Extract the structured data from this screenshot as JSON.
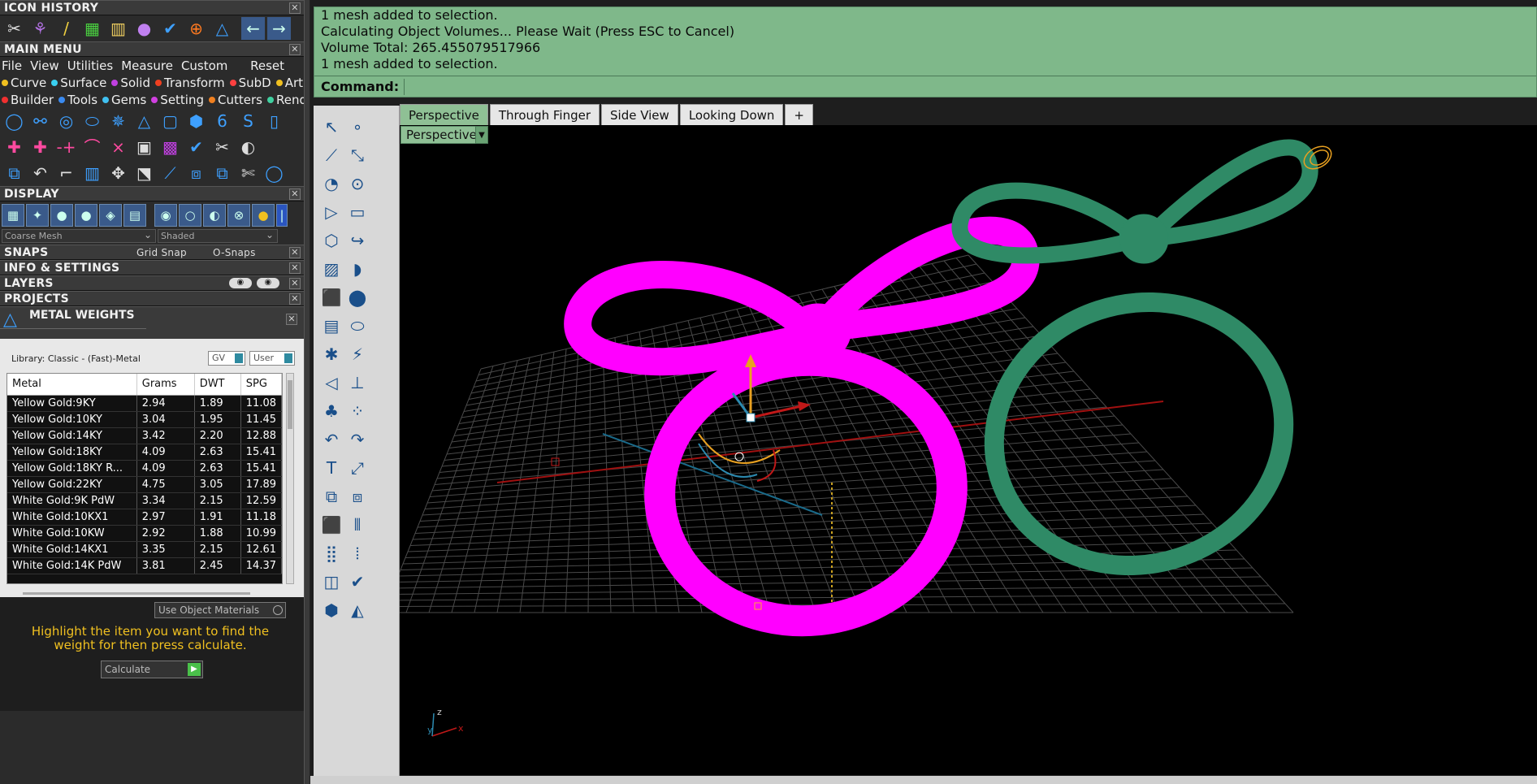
{
  "icon_history": {
    "title": "ICON HISTORY",
    "close": "✕"
  },
  "main_menu": {
    "title": "MAIN MENU",
    "close": "✕",
    "items": [
      "File",
      "View",
      "Utilities",
      "Measure",
      "Custom"
    ],
    "reset": "Reset",
    "cat_row1": [
      {
        "label": "Curve",
        "color": "#f0c020"
      },
      {
        "label": "Surface",
        "color": "#3ad0f0"
      },
      {
        "label": "Solid",
        "color": "#c040e0"
      },
      {
        "label": "Transform",
        "color": "#f04020"
      },
      {
        "label": "SubD",
        "color": "#ff4040"
      },
      {
        "label": "Art",
        "color": "#f0c020"
      }
    ],
    "cat_row2": [
      {
        "label": "Builder",
        "color": "#f03030"
      },
      {
        "label": "Tools",
        "color": "#3a8af0"
      },
      {
        "label": "Gems",
        "color": "#40c0f0"
      },
      {
        "label": "Setting",
        "color": "#d040e0"
      },
      {
        "label": "Cutters",
        "color": "#f08020"
      },
      {
        "label": "Render",
        "color": "#40d0a0"
      }
    ]
  },
  "display": {
    "title": "DISPLAY",
    "close": "✕",
    "mesh_combo": "Coarse Mesh",
    "shade_combo": "Shaded"
  },
  "snaps": {
    "title": "SNAPS",
    "grid_snap": "Grid Snap",
    "osnaps": "O-Snaps",
    "close": "✕"
  },
  "info": {
    "title": "INFO & SETTINGS",
    "close": "✕"
  },
  "layers": {
    "title": "LAYERS",
    "close": "✕"
  },
  "projects": {
    "title": "PROJECTS",
    "close": "✕"
  },
  "metal_weights": {
    "title": "METAL WEIGHTS",
    "close": "✕",
    "library": "Library: Classic - (Fast)-Metal",
    "gv": "GV",
    "user": "User",
    "columns": [
      "Metal",
      "Grams",
      "DWT",
      "SPG"
    ],
    "rows": [
      [
        "Yellow Gold:9KY",
        "2.94",
        "1.89",
        "11.08"
      ],
      [
        "Yellow Gold:10KY",
        "3.04",
        "1.95",
        "11.45"
      ],
      [
        "Yellow Gold:14KY",
        "3.42",
        "2.20",
        "12.88"
      ],
      [
        "Yellow Gold:18KY",
        "4.09",
        "2.63",
        "15.41"
      ],
      [
        "Yellow Gold:18KY R...",
        "4.09",
        "2.63",
        "15.41"
      ],
      [
        "Yellow Gold:22KY",
        "4.75",
        "3.05",
        "17.89"
      ],
      [
        "White Gold:9K PdW",
        "3.34",
        "2.15",
        "12.59"
      ],
      [
        "White Gold:10KX1",
        "2.97",
        "1.91",
        "11.18"
      ],
      [
        "White Gold:10KW",
        "2.92",
        "1.88",
        "10.99"
      ],
      [
        "White Gold:14KX1",
        "3.35",
        "2.15",
        "12.61"
      ],
      [
        "White Gold:14K PdW",
        "3.81",
        "2.45",
        "14.37"
      ]
    ],
    "use_object_materials": "Use Object Materials",
    "hint": "Highlight the item you want to find the weight for then press calculate.",
    "calculate": "Calculate"
  },
  "command_area": {
    "lines": [
      "1 mesh added to selection.",
      "Calculating Object Volumes... Please Wait (Press ESC to Cancel)",
      "Volume Total: 265.455079517966",
      "1 mesh added to selection."
    ],
    "command_label": "Command:"
  },
  "viewport": {
    "tabs": [
      "Perspective",
      "Through Finger",
      "Side View",
      "Looking Down"
    ],
    "add_tab": "+",
    "label": "Perspective",
    "axis_x": "x",
    "axis_y": "y",
    "axis_z": "z"
  },
  "colors": {
    "magenta": "#ff00ff",
    "green": "#2f8a66",
    "accent": "#8fc095"
  }
}
